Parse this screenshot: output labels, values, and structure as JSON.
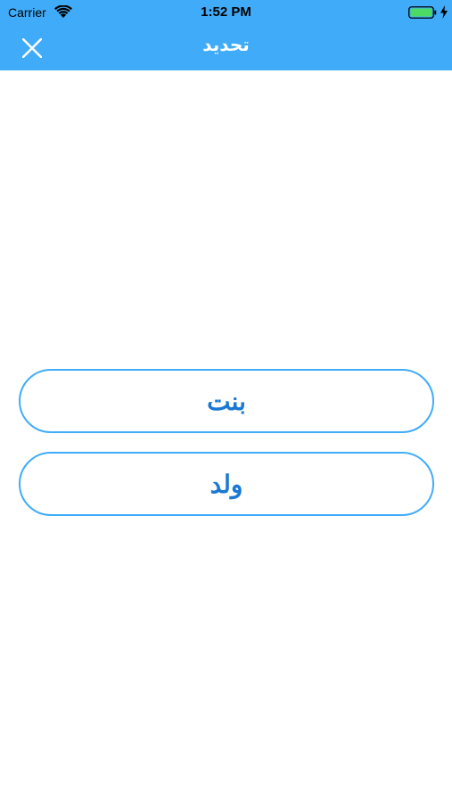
{
  "status_bar": {
    "carrier": "Carrier",
    "time": "1:52 PM",
    "icons": [
      "wifi-icon",
      "battery-icon",
      "charging-icon"
    ]
  },
  "nav": {
    "title": "تحديد",
    "close_icon": "close-icon",
    "bar_color": "#40acf9"
  },
  "options": [
    {
      "label": "بنت"
    },
    {
      "label": "ولد"
    }
  ],
  "colors": {
    "accent": "#40acf9",
    "button_text": "#1a78d4",
    "battery": "#4cd964"
  }
}
